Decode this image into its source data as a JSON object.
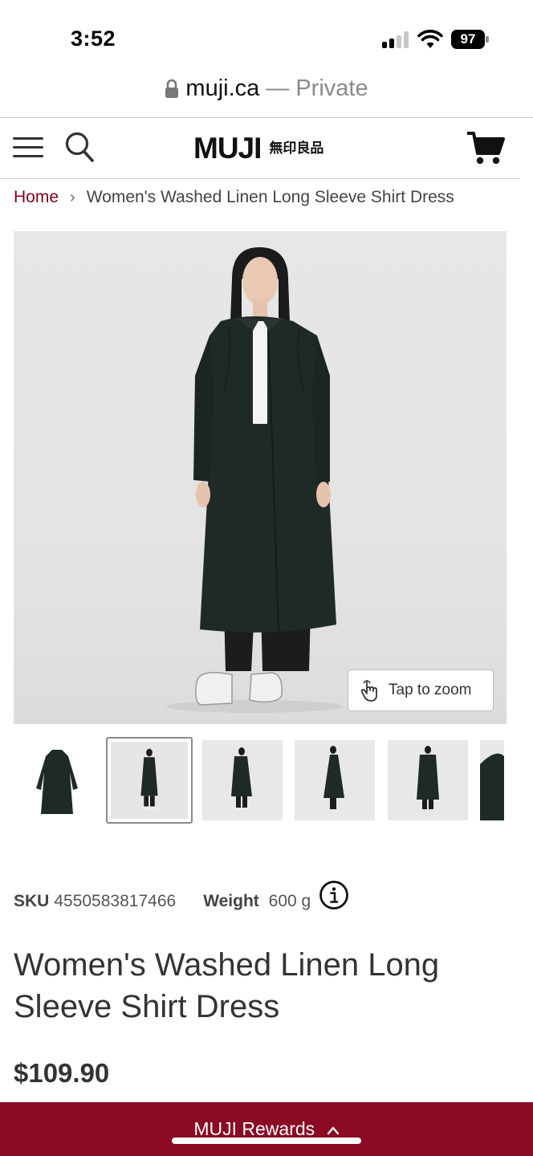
{
  "status_bar": {
    "time": "3:52",
    "battery": "97",
    "signal_bars_active": 2,
    "signal_bars_total": 4
  },
  "browser": {
    "domain": "muji.ca",
    "mode": "— Private"
  },
  "header": {
    "logo_latin": "MUJI",
    "logo_kanji": "無印良品",
    "icons": [
      "hamburger-icon",
      "search-icon",
      "cart-icon"
    ]
  },
  "breadcrumb": {
    "home": "Home",
    "current": "Women's Washed Linen Long Sleeve Shirt Dress"
  },
  "gallery": {
    "zoom_label": "Tap to zoom",
    "selected_thumbnail": 1,
    "thumbnail_count": 6
  },
  "product": {
    "sku_label": "SKU",
    "sku_value": "4550583817466",
    "weight_label": "Weight",
    "weight_value": "600 g",
    "title": "Women's Washed Linen Long Sleeve Shirt Dress",
    "price": "$109.90"
  },
  "rewards": {
    "label": "MUJI Rewards"
  },
  "colors": {
    "brand": "#8b0a23",
    "breadcrumb_link": "#7f0019",
    "garment": "#1f2a26"
  }
}
